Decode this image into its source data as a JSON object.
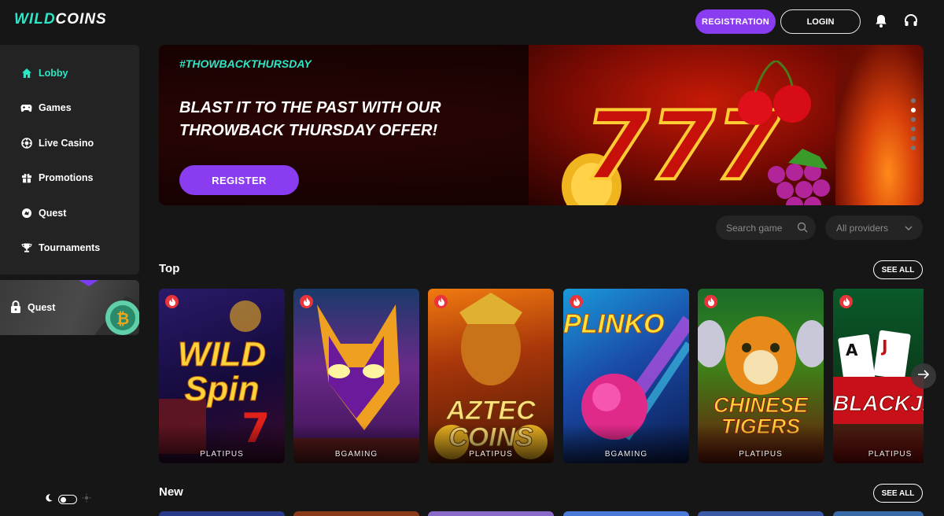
{
  "header": {
    "logo_part1": "WILD",
    "logo_part2": "COINS",
    "registration_label": "REGISTRATION",
    "login_label": "LOGIN",
    "icons": [
      "bell-icon",
      "headset-icon"
    ]
  },
  "sidebar": {
    "items": [
      {
        "label": "Lobby",
        "icon": "home-icon",
        "active": true
      },
      {
        "label": "Games",
        "icon": "gamepad-icon",
        "active": false
      },
      {
        "label": "Live Casino",
        "icon": "live-casino-icon",
        "active": false
      },
      {
        "label": "Promotions",
        "icon": "gift-icon",
        "active": false
      },
      {
        "label": "Quest",
        "icon": "quest-icon",
        "active": false
      },
      {
        "label": "Tournaments",
        "icon": "trophy-icon",
        "active": false
      }
    ],
    "quest_card_label": "Quest",
    "theme_toggle": {
      "mode": "dark"
    }
  },
  "banner": {
    "hashtag": "#THOWBACKTHURSDAY",
    "headline_line1": "BLAST IT TO THE PAST WITH OUR",
    "headline_line2": "THROWBACK THURSDAY OFFER!",
    "cta_label": "REGISTER",
    "slide_dots": 6,
    "active_slide": 2
  },
  "filters": {
    "search_placeholder": "Search game",
    "providers_label": "All providers"
  },
  "sections": {
    "top": {
      "title": "Top",
      "see_all": "SEE ALL"
    },
    "new": {
      "title": "New",
      "see_all": "SEE ALL"
    }
  },
  "top_games": [
    {
      "title": "WILD Spin",
      "provider": "PLATIPUS"
    },
    {
      "title": "",
      "provider": "BGAMING"
    },
    {
      "title": "AZTEC COINS",
      "provider": "PLATIPUS"
    },
    {
      "title": "PLINKO",
      "provider": "BGAMING"
    },
    {
      "title": "CHINESE TIGERS",
      "provider": "PLATIPUS"
    },
    {
      "title": "BLACKJA",
      "provider": "PLATIPUS"
    }
  ],
  "colors": {
    "accent_teal": "#2ee6c5",
    "accent_purple": "#8a3cf0",
    "background": "#161616",
    "hot_badge": "#e8343a"
  }
}
